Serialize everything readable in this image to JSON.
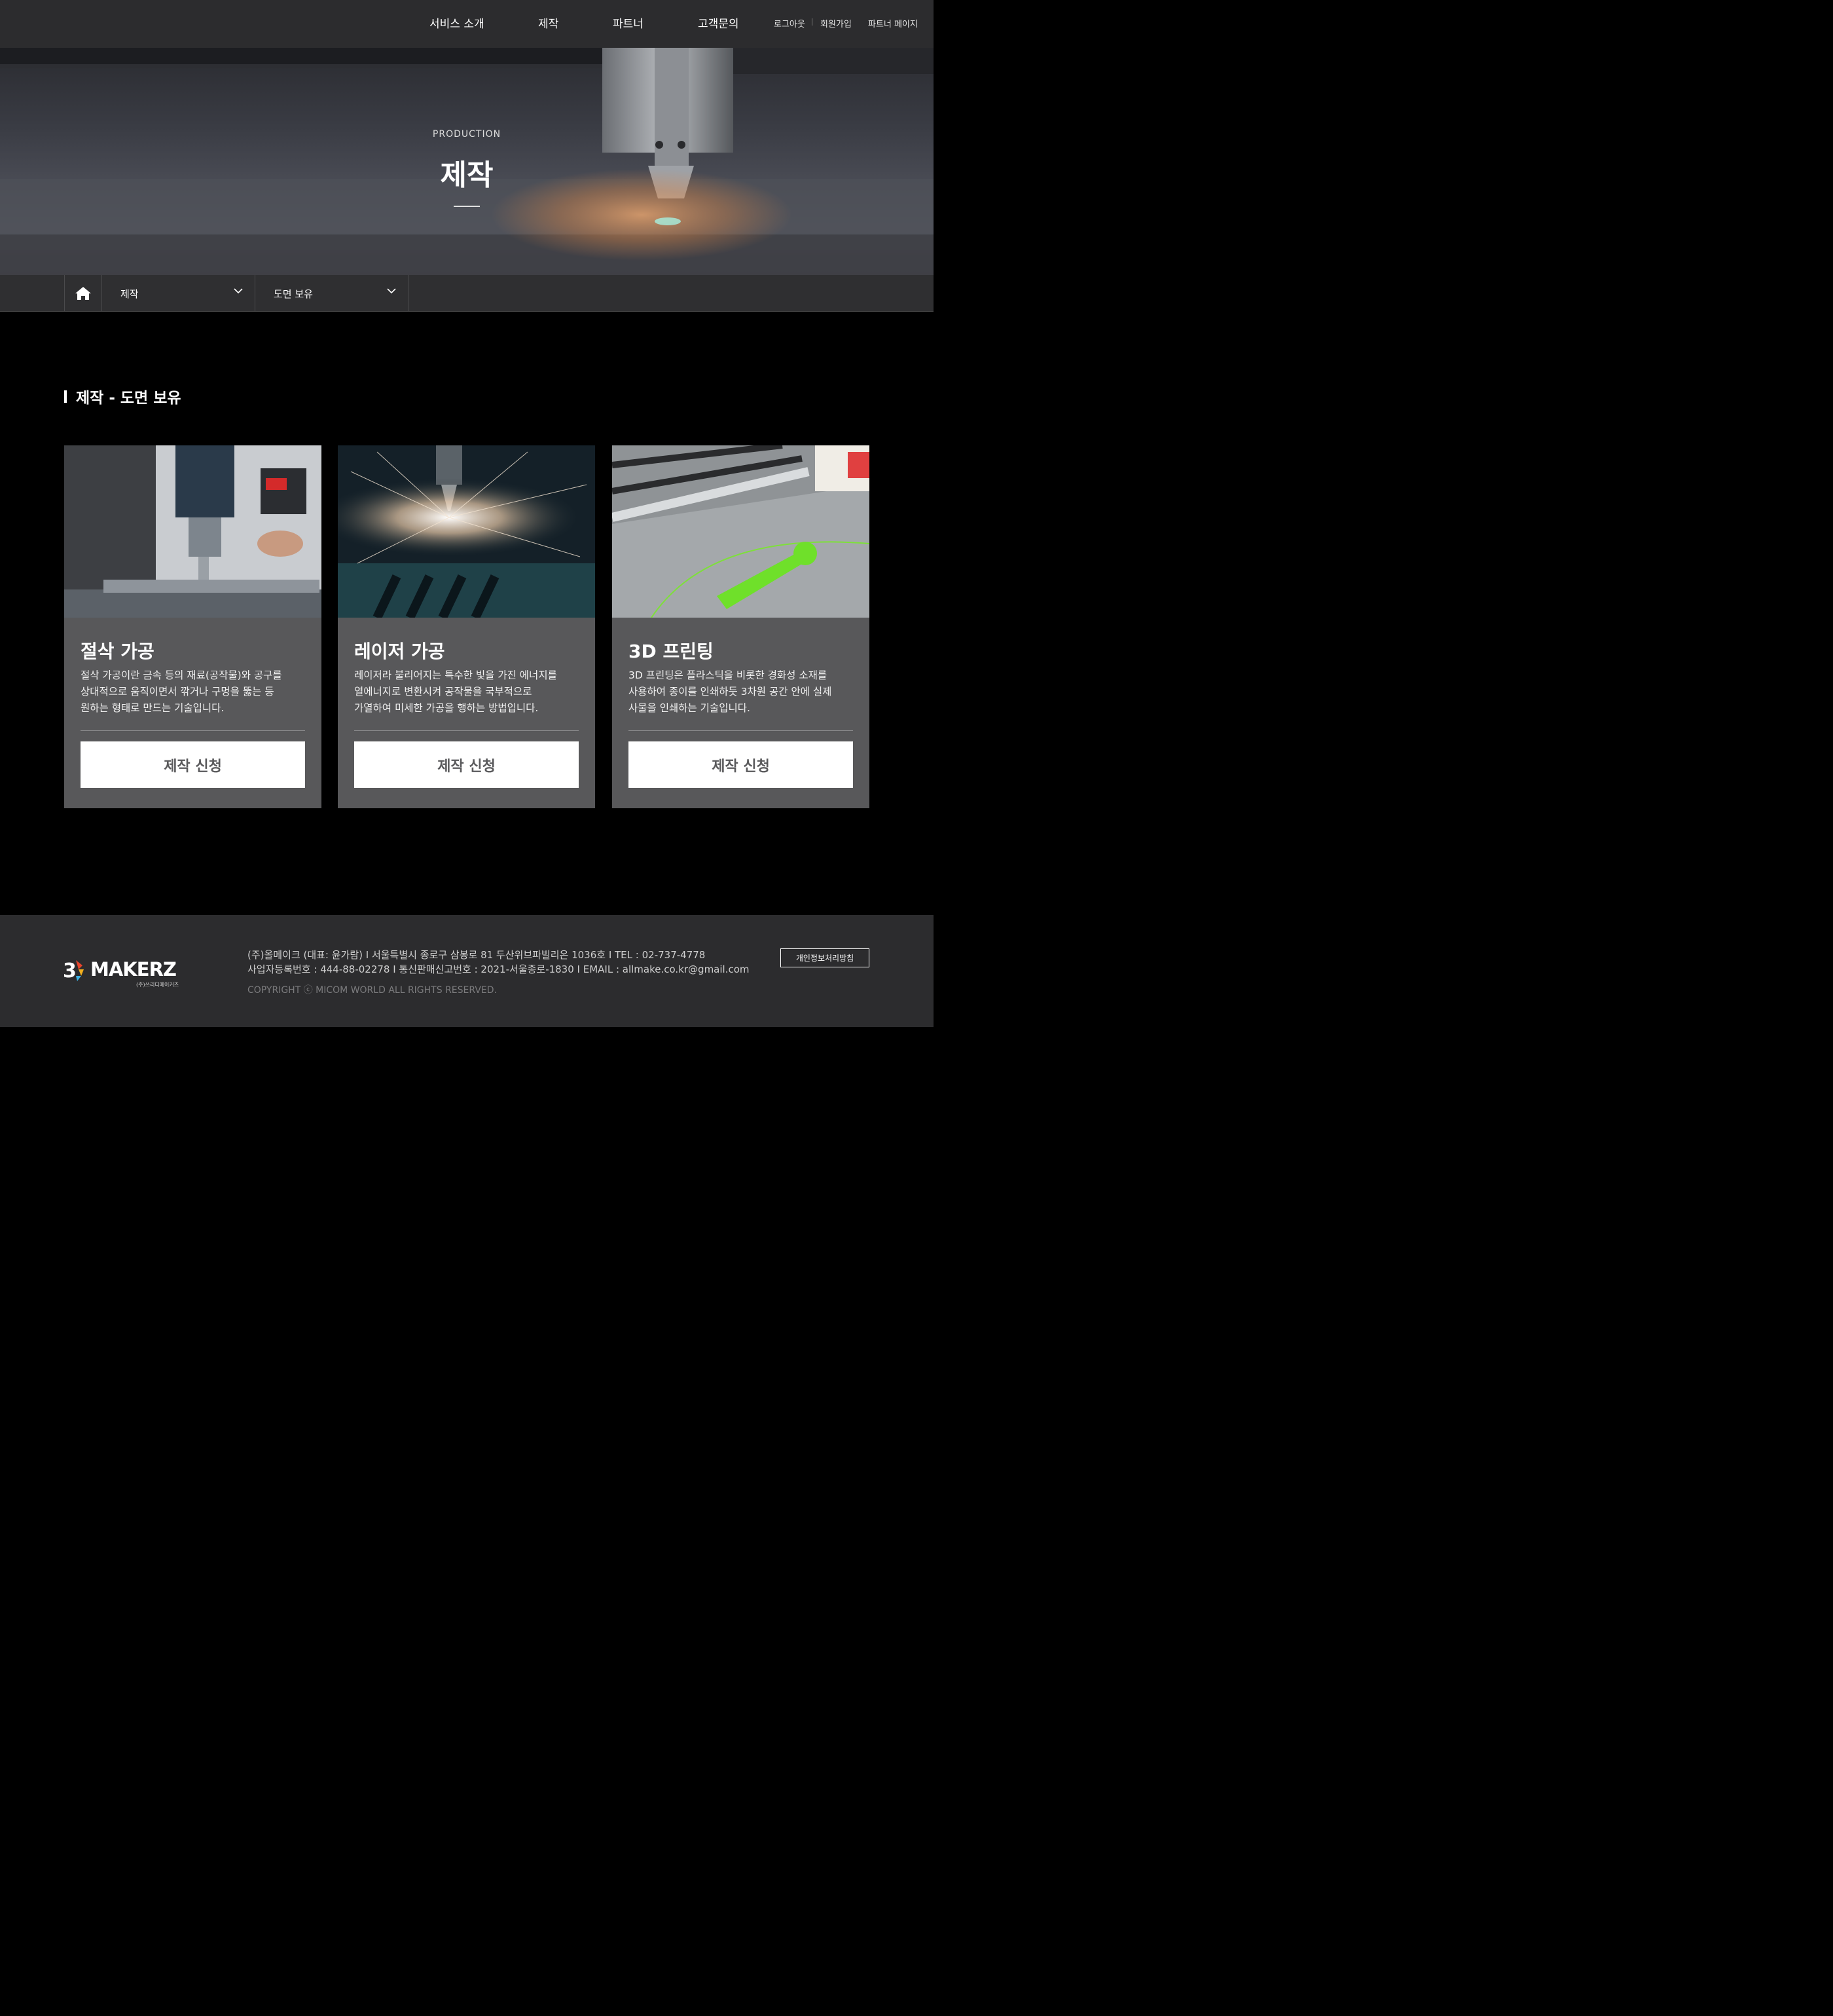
{
  "header": {
    "nav": [
      "서비스 소개",
      "제작",
      "파트너",
      "고객문의"
    ],
    "util": {
      "logout": "로그아웃",
      "signup": "회원가입",
      "partner_page": "파트너 페이지"
    }
  },
  "hero": {
    "subtitle": "PRODUCTION",
    "title": "제작"
  },
  "breadcrumb": {
    "level1": "제작",
    "level2": "도면 보유"
  },
  "section": {
    "title": "제작 - 도면 보유"
  },
  "cards": [
    {
      "title": "절삭 가공",
      "desc": [
        "절삭 가공이란 금속 등의 재료(공작물)와 공구를",
        "상대적으로 움직이면서 깎거나 구멍을 뚫는 등",
        "원하는 형태로 만드는 기술입니다."
      ],
      "button": "제작 신청"
    },
    {
      "title": "레이저 가공",
      "desc": [
        "레이저라 불리어지는 특수한 빛을 가진 에너지를",
        "열에너지로 변환시켜 공작물을 국부적으로",
        "가열하여 미세한 가공을 행하는 방법입니다."
      ],
      "button": "제작 신청"
    },
    {
      "title": "3D 프린팅",
      "desc": [
        "3D 프린팅은 플라스틱을 비롯한 경화성 소재를",
        "사용하여 종이를 인쇄하듯 3차원 공간 안에 실제",
        "사물을 인쇄하는 기술입니다."
      ],
      "button": "제작 신청"
    }
  ],
  "footer": {
    "logo_text": "MAKERZ",
    "logo_sub": "(주)쓰리디메이커즈",
    "line1": "(주)올메이크 (대표: 윤가람) I 서울특별시 종로구 삼봉로 81 두산위브파빌리온 1036호 I TEL : 02-737-4778",
    "line2": "사업자등록번호 : 444-88-02278 I 통신판매신고번호 : 2021-서울종로-1830 I EMAIL : allmake.co.kr@gmail.com",
    "copyright": "COPYRIGHT ⓒ MICOM WORLD ALL RIGHTS RESERVED.",
    "privacy": "개인정보처리방침"
  }
}
